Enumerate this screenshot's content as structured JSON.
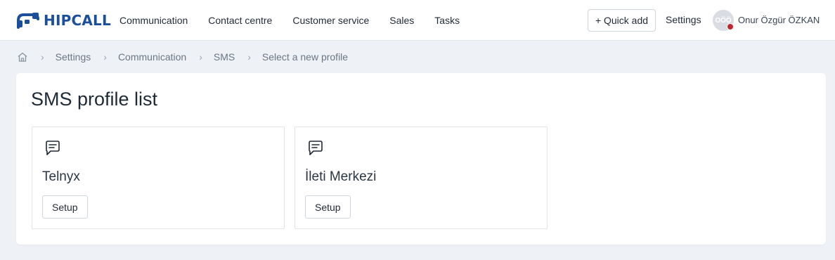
{
  "brand": {
    "name": "HIPCALL",
    "color": "#1b4f9b"
  },
  "nav": {
    "items": [
      {
        "label": "Communication"
      },
      {
        "label": "Contact centre"
      },
      {
        "label": "Customer service"
      },
      {
        "label": "Sales"
      },
      {
        "label": "Tasks"
      }
    ]
  },
  "header": {
    "quick_add_label": "+ Quick add",
    "settings_label": "Settings",
    "user": {
      "initials": "OÖÖ",
      "name": "Onur Özgür ÖZKAN",
      "status_color": "#c0262d"
    }
  },
  "breadcrumb": {
    "home_icon": "home-icon",
    "items": [
      {
        "label": "Settings"
      },
      {
        "label": "Communication"
      },
      {
        "label": "SMS"
      },
      {
        "label": "Select a new profile"
      }
    ]
  },
  "main": {
    "title": "SMS profile list",
    "cards": [
      {
        "icon": "message-icon",
        "title": "Telnyx",
        "button_label": "Setup"
      },
      {
        "icon": "message-icon",
        "title": "İleti Merkezi",
        "button_label": "Setup"
      }
    ]
  }
}
